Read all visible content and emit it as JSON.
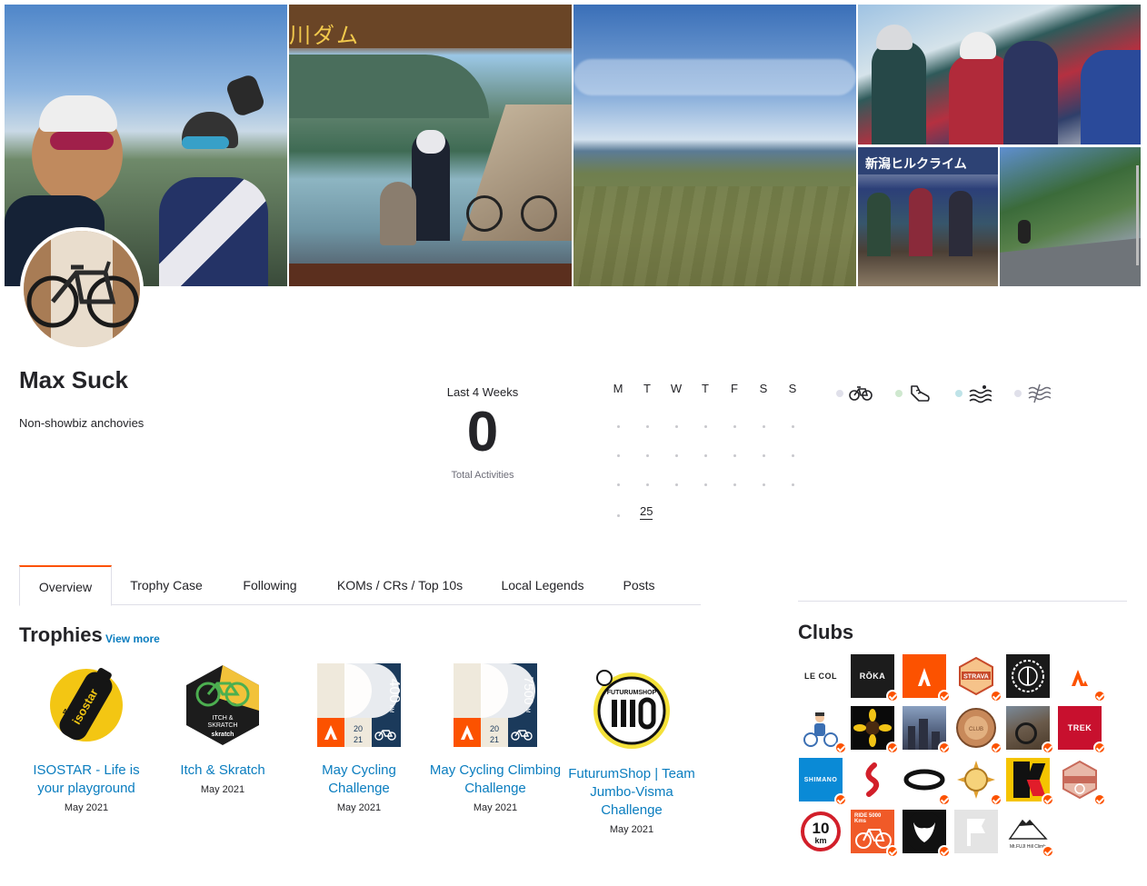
{
  "athlete": {
    "name": "Max Suck",
    "bio": "Non-showbiz anchovies"
  },
  "stats": {
    "period_label": "Last 4 Weeks",
    "total_activities": "0",
    "total_label": "Total Activities"
  },
  "calendar": {
    "day_headers": [
      "M",
      "T",
      "W",
      "T",
      "F",
      "S",
      "S"
    ],
    "highlight_date": "25"
  },
  "sports": [
    {
      "name": "bike-icon",
      "dot_color": "#e0e0ea"
    },
    {
      "name": "run-shoe-icon",
      "dot_color": "#cfe8cf"
    },
    {
      "name": "swim-icon",
      "dot_color": "#bfe3e8"
    },
    {
      "name": "other-activity-icon",
      "dot_color": "#e0e0ea"
    }
  ],
  "tabs": [
    {
      "label": "Overview",
      "active": true
    },
    {
      "label": "Trophy Case",
      "active": false
    },
    {
      "label": "Following",
      "active": false
    },
    {
      "label": "KOMs / CRs / Top 10s",
      "active": false
    },
    {
      "label": "Local Legends",
      "active": false
    },
    {
      "label": "Posts",
      "active": false
    }
  ],
  "trophies": {
    "title": "Trophies",
    "view_more": "View more",
    "items": [
      {
        "name": "ISOSTAR - Life is your playground",
        "date": "May 2021",
        "badge": "isostar-bottle-icon"
      },
      {
        "name": "Itch & Skratch",
        "date": "May 2021",
        "badge": "itch-skratch-badge-icon"
      },
      {
        "name": "May Cycling Challenge",
        "date": "May 2021",
        "badge": "cycling-challenge-badge-icon",
        "badge_text": "400",
        "badge_unit": "KM",
        "badge_year_top": "20",
        "badge_year_bottom": "21"
      },
      {
        "name": "May Cycling Climbing Challenge",
        "date": "May 2021",
        "badge": "climbing-challenge-badge-icon",
        "badge_text": "7500",
        "badge_unit": "M",
        "badge_year_top": "20",
        "badge_year_bottom": "21"
      },
      {
        "name": "FuturumShop | Team Jumbo-Visma Challenge",
        "date": "May 2021",
        "badge": "futurumshop-badge-icon",
        "badge_text": "FUTURUMSHOP"
      }
    ]
  },
  "clubs": {
    "title": "Clubs",
    "items": [
      {
        "name": "le-col-club",
        "label": "LE COL",
        "bg": "#ffffff",
        "fg": "#222222",
        "verified": false
      },
      {
        "name": "roka-club",
        "label": "RŌKA",
        "bg": "#1c1c1c",
        "fg": "#ffffff",
        "verified": true
      },
      {
        "name": "strava-club",
        "label": "",
        "bg": "#fc5200",
        "fg": "#ffffff",
        "verified": true
      },
      {
        "name": "strava-badge-club",
        "label": "STRAVA",
        "bg": "#ffffff",
        "fg": "#c84a2a",
        "verified": true
      },
      {
        "name": "strava-gear-club",
        "label": "",
        "bg": "#1a1a1a",
        "fg": "#ffffff",
        "verified": false
      },
      {
        "name": "strava-logo-club",
        "label": "",
        "bg": "#ffffff",
        "fg": "#fc5200",
        "verified": true
      },
      {
        "name": "cyclist-illustration-club",
        "label": "",
        "bg": "#ffffff",
        "fg": "#3b6fb3",
        "verified": true
      },
      {
        "name": "sunflower-club",
        "label": "",
        "bg": "#0a0a0a",
        "fg": "#f2c416",
        "verified": true
      },
      {
        "name": "city-photo-club",
        "label": "",
        "bg": "#6e7f9a",
        "fg": "#ffffff",
        "verified": true
      },
      {
        "name": "circle-badge-club",
        "label": "",
        "bg": "#ffffff",
        "fg": "#b06a3a",
        "verified": true
      },
      {
        "name": "mtb-photo-club",
        "label": "",
        "bg": "#6a5a4a",
        "fg": "#ffffff",
        "verified": true
      },
      {
        "name": "trek-club",
        "label": "TREK",
        "bg": "#c8102e",
        "fg": "#ffffff",
        "verified": true
      },
      {
        "name": "shimano-club",
        "label": "SHIMANO",
        "bg": "#0a8ad6",
        "fg": "#ffffff",
        "verified": true
      },
      {
        "name": "specialized-club",
        "label": "",
        "bg": "#ffffff",
        "fg": "#d21f2a",
        "verified": false
      },
      {
        "name": "oakley-club",
        "label": "",
        "bg": "#ffffff",
        "fg": "#111111",
        "verified": true
      },
      {
        "name": "sun-badge-club",
        "label": "",
        "bg": "#ffffff",
        "fg": "#e0a030",
        "verified": true
      },
      {
        "name": "k-club",
        "label": "k",
        "bg": "#f5c400",
        "fg": "#111111",
        "verified": true
      },
      {
        "name": "saitama-badge-club",
        "label": "",
        "bg": "#ffffff",
        "fg": "#c86a5a",
        "verified": true
      },
      {
        "name": "10km-club",
        "label": "10 km",
        "bg": "#ffffff",
        "fg": "#111111",
        "verified": false
      },
      {
        "name": "ride-5000km-club",
        "label": "RIDE 5000 Kms",
        "bg": "#f05a28",
        "fg": "#ffffff",
        "verified": true
      },
      {
        "name": "bull-club",
        "label": "",
        "bg": "#111111",
        "fg": "#ffffff",
        "verified": true
      },
      {
        "name": "flag-club",
        "label": "",
        "bg": "#e4e4e4",
        "fg": "#ffffff",
        "verified": false
      },
      {
        "name": "mt-fuji-club",
        "label": "Mt.FUJI Hill Climb",
        "bg": "#ffffff",
        "fg": "#222222",
        "verified": true
      }
    ]
  },
  "colors": {
    "accent": "#fc5200",
    "link": "#0a7dbf",
    "text": "#242428",
    "muted": "#6d6d78"
  },
  "cover": {
    "photos": [
      "cyclists-selfie-photo",
      "dam-rider-photo",
      "landscape-photo",
      "group-riders-photo",
      "podium-photo",
      "mountain-road-photo"
    ]
  }
}
